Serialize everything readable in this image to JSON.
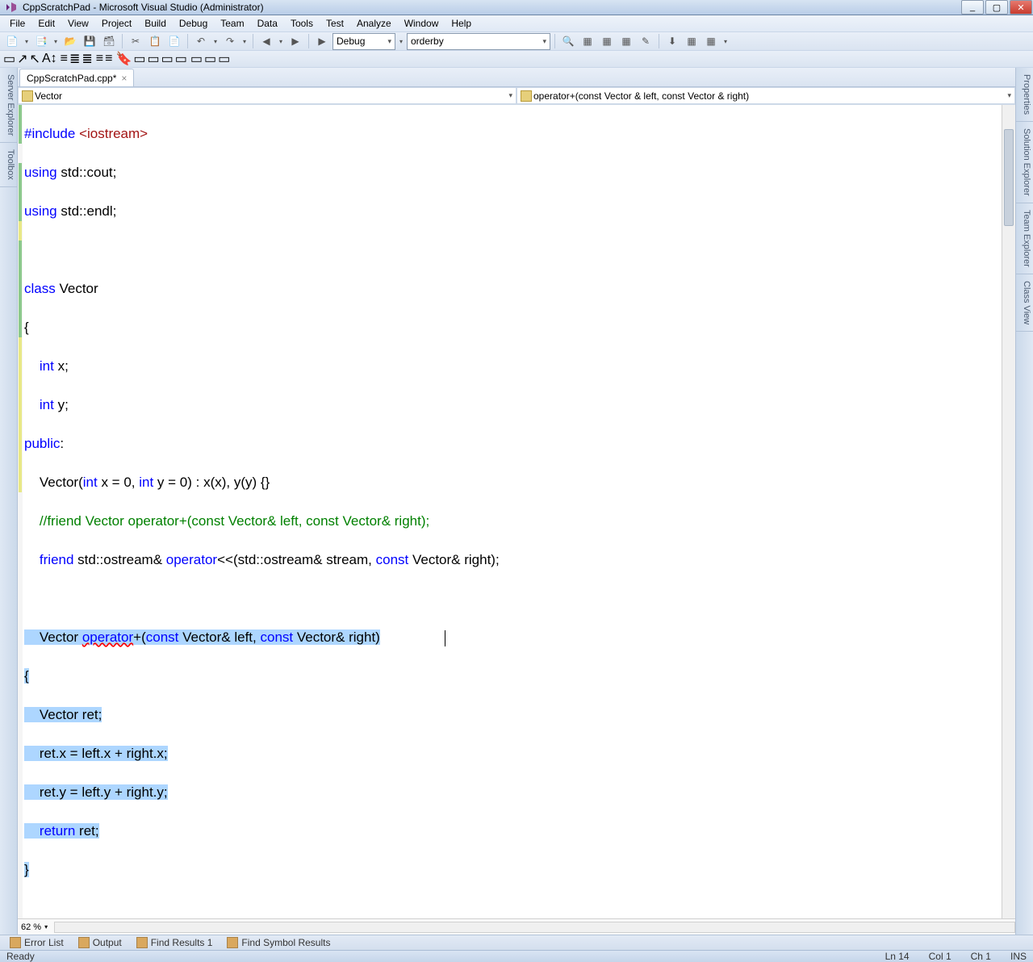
{
  "title": "CppScratchPad - Microsoft Visual Studio (Administrator)",
  "menu": [
    "File",
    "Edit",
    "View",
    "Project",
    "Build",
    "Debug",
    "Team",
    "Data",
    "Tools",
    "Test",
    "Analyze",
    "Window",
    "Help"
  ],
  "toolbar": {
    "config": "Debug",
    "search": "orderby"
  },
  "doc_tab": "CppScratchPad.cpp*",
  "nav": {
    "scope": "Vector",
    "member": "operator+(const Vector & left, const Vector & right)"
  },
  "left_docks": [
    "Server Explorer",
    "Toolbox"
  ],
  "right_docks": [
    "Properties",
    "Solution Explorer",
    "Team Explorer",
    "Class View"
  ],
  "code": {
    "l1_include": "#include ",
    "l1_iostream": "<iostream>",
    "l2_using": "using ",
    "l2_std": "std::cout;",
    "l3_using": "using ",
    "l3_std": "std::endl;",
    "l5_class": "class ",
    "l5_vector": "Vector",
    "l6_brace": "{",
    "l7": "    int x;",
    "l7_int": "int",
    "l7_rest": " x;",
    "l8_int": "int",
    "l8_rest": " y;",
    "l9_public": "public",
    "l9_colon": ":",
    "l10_pre": "    Vector(",
    "l10_int1": "int",
    "l10_mid1": " x = 0, ",
    "l10_int2": "int",
    "l10_mid2": " y = 0) : x(x), y(y) {}",
    "l11_comment": "    //friend Vector operator+(const Vector& left, const Vector& right);",
    "l12_pre": "    ",
    "l12_friend": "friend",
    "l12_mid1": " std::ostream& ",
    "l12_op": "operator",
    "l12_mid2": "<<(std::ostream& stream, ",
    "l12_const": "const",
    "l12_mid3": " Vector& right);",
    "l14_pre": "    Vector ",
    "l14_op": "operator",
    "l14_plus": "+(",
    "l14_const1": "const",
    "l14_mid1": " Vector& left, ",
    "l14_const2": "const",
    "l14_end": " Vector& right)",
    "l15": "{",
    "l16": "    Vector ret;",
    "l17": "    ret.x = left.x + right.x;",
    "l18": "    ret.y = left.y + right.y;",
    "l19_pre": "    ",
    "l19_return": "return",
    "l19_rest": " ret;",
    "l20": "}"
  },
  "zoom": "62 %",
  "bottom_tabs": [
    "Error List",
    "Output",
    "Find Results 1",
    "Find Symbol Results"
  ],
  "status": {
    "left": "Ready",
    "ln": "Ln 14",
    "col": "Col 1",
    "ch": "Ch 1",
    "ins": "INS"
  }
}
